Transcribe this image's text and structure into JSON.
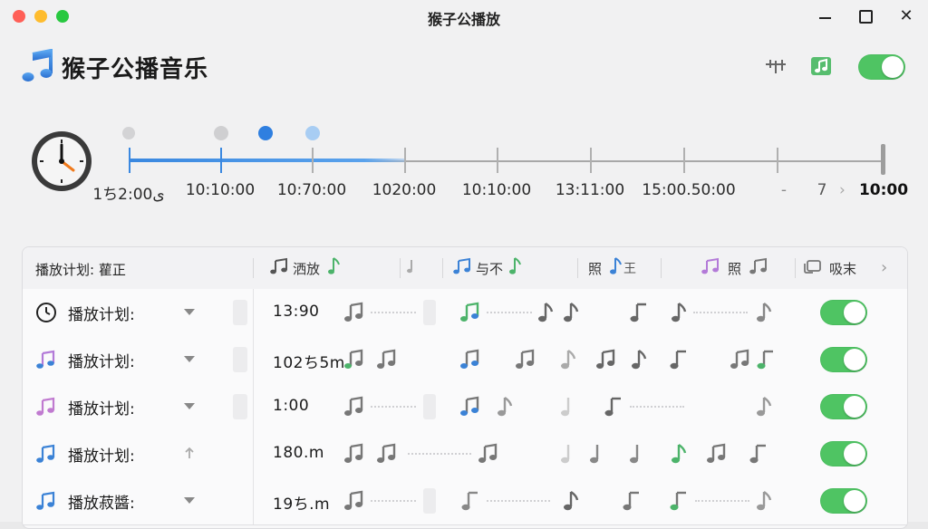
{
  "window": {
    "title": "猴子公播放"
  },
  "app": {
    "title": "猴子公播音乐"
  },
  "timeline": {
    "labels": [
      "1ちﻯ2:00",
      "10:10:00",
      "10:70:00",
      "1020:00",
      "10:10:00",
      "13:11:00",
      "15:00.50:00",
      "-",
      "7",
      "10:00"
    ],
    "progress_fraction": 0.37
  },
  "table": {
    "header_first": "播放计划:  雚正",
    "header_cols": [
      "洒放",
      "",
      "与不",
      "照",
      "照",
      "吸末"
    ],
    "rows": [
      {
        "label": "播放计划:",
        "time": "13:90",
        "toggle_on": true
      },
      {
        "label": "播放计划:",
        "time": "102ち5m",
        "toggle_on": true
      },
      {
        "label": "播放计划:",
        "time": "1:00",
        "toggle_on": true
      },
      {
        "label": "播放计划:",
        "time": "180.m",
        "toggle_on": true
      },
      {
        "label": "播放菽醬:",
        "time": "19ち.m",
        "toggle_on": true
      }
    ]
  },
  "colors": {
    "accent_blue": "#3a88e0",
    "toggle_green": "#4fc463",
    "note_green": "#4cb36a",
    "note_purple": "#b37ad8",
    "note_blue": "#3b82d6"
  },
  "icons": [
    "music-note-icon",
    "clock-icon",
    "equalizer-icon",
    "music-file-icon",
    "chevron-right-icon",
    "chevron-down-icon"
  ]
}
